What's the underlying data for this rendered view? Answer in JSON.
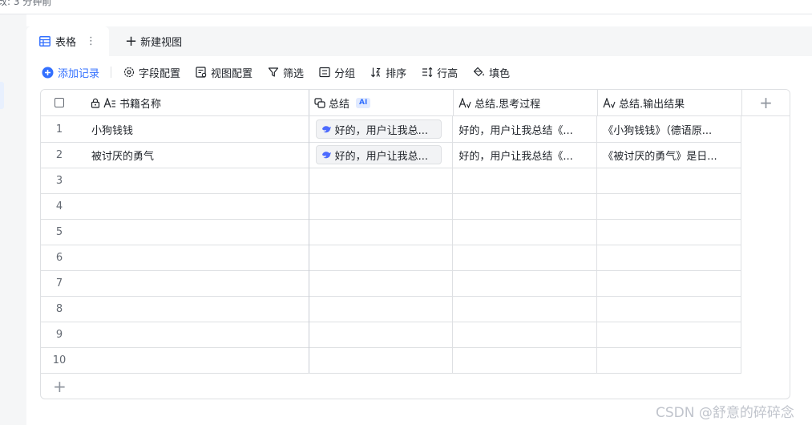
{
  "status": {
    "text": "改: 3 分钟前"
  },
  "tabs": {
    "active_label": "表格",
    "more_glyph": "⋮",
    "new_view_label": "新建视图",
    "new_view_plus": "+"
  },
  "toolbar": {
    "add_record": "添加记录",
    "field_config": "字段配置",
    "view_config": "视图配置",
    "filter": "筛选",
    "group": "分组",
    "sort": "排序",
    "row_height": "行高",
    "fill_color": "填色"
  },
  "table": {
    "headers": {
      "name": "书籍名称",
      "summary": "总结",
      "summary_badge": "AI",
      "thinking": "总结.思考过程",
      "output": "总结.输出结果",
      "add_column": "+"
    },
    "rows": [
      {
        "index": "1",
        "name": "小狗钱钱",
        "summary": "好的，用户让我总...",
        "thinking": "好的，用户让我总结《...",
        "output": "《小狗钱钱》（德语原..."
      },
      {
        "index": "2",
        "name": "被讨厌的勇气",
        "summary": "好的，用户让我总...",
        "thinking": "好的，用户让我总结《...",
        "output": "《被讨厌的勇气》是日..."
      },
      {
        "index": "3",
        "name": "",
        "summary": "",
        "thinking": "",
        "output": ""
      },
      {
        "index": "4",
        "name": "",
        "summary": "",
        "thinking": "",
        "output": ""
      },
      {
        "index": "5",
        "name": "",
        "summary": "",
        "thinking": "",
        "output": ""
      },
      {
        "index": "6",
        "name": "",
        "summary": "",
        "thinking": "",
        "output": ""
      },
      {
        "index": "7",
        "name": "",
        "summary": "",
        "thinking": "",
        "output": ""
      },
      {
        "index": "8",
        "name": "",
        "summary": "",
        "thinking": "",
        "output": ""
      },
      {
        "index": "9",
        "name": "",
        "summary": "",
        "thinking": "",
        "output": ""
      },
      {
        "index": "10",
        "name": "",
        "summary": "",
        "thinking": "",
        "output": ""
      }
    ],
    "add_row": "+"
  },
  "watermark": "CSDN @舒意的碎碎念",
  "colors": {
    "accent": "#3370ff",
    "border": "#dee0e3",
    "text": "#1f2329",
    "muted": "#646a73"
  },
  "icons": {
    "tab": "table-grid-icon",
    "add_record": "plus-circle-icon",
    "field_config": "gear-icon",
    "view_config": "view-settings-icon",
    "filter": "filter-funnel-icon",
    "group": "group-list-icon",
    "sort": "sort-icon",
    "row_height": "row-height-icon",
    "fill_color": "paint-bucket-icon",
    "lock": "lock-icon",
    "text_field": "text-field-icon",
    "ai_field": "ai-field-icon",
    "chip_model": "model-logo-icon"
  }
}
